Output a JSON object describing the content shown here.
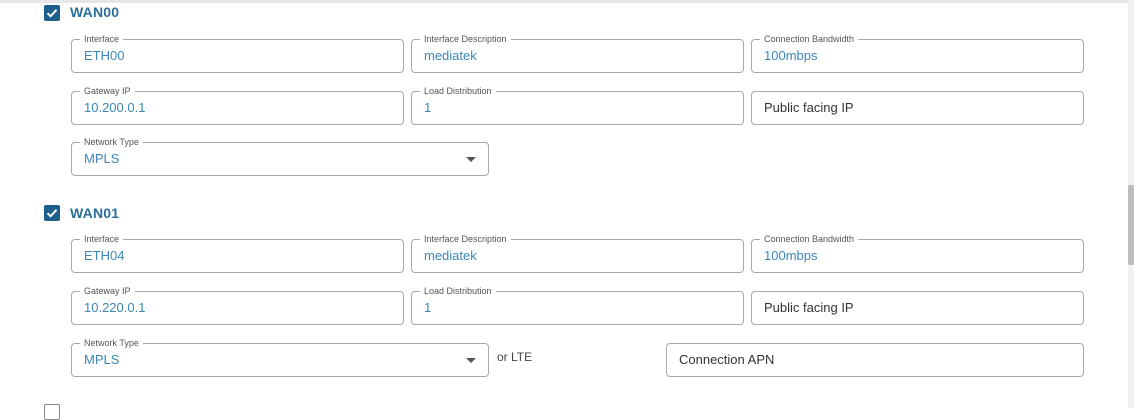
{
  "wan00": {
    "title": "WAN00",
    "checked": true,
    "interface": {
      "label": "Interface",
      "value": "ETH00"
    },
    "interface_description": {
      "label": "Interface Description",
      "value": "mediatek"
    },
    "connection_bandwidth": {
      "label": "Connection Bandwidth",
      "value": "100mbps"
    },
    "gateway_ip": {
      "label": "Gateway IP",
      "value": "10.200.0.1"
    },
    "load_distribution": {
      "label": "Load Distribution",
      "value": "1"
    },
    "public_ip": {
      "placeholder": "Public facing IP"
    },
    "network_type": {
      "label": "Network Type",
      "value": "MPLS"
    }
  },
  "wan01": {
    "title": "WAN01",
    "checked": true,
    "interface": {
      "label": "Interface",
      "value": "ETH04"
    },
    "interface_description": {
      "label": "Interface Description",
      "value": "mediatek"
    },
    "connection_bandwidth": {
      "label": "Connection Bandwidth",
      "value": "100mbps"
    },
    "gateway_ip": {
      "label": "Gateway IP",
      "value": "10.220.0.1"
    },
    "load_distribution": {
      "label": "Load Distribution",
      "value": "1"
    },
    "public_ip": {
      "placeholder": "Public facing IP"
    },
    "network_type": {
      "label": "Network Type",
      "value": "MPLS"
    },
    "or_lte": "or LTE",
    "connection_apn": {
      "placeholder": "Connection APN"
    }
  },
  "colors": {
    "accent": "#1d5e8b",
    "value_text": "#3a87b8",
    "title_text": "#2b6f98"
  },
  "icons": {
    "checkbox": "checkmark-icon",
    "dropdown": "chevron-down-icon"
  }
}
